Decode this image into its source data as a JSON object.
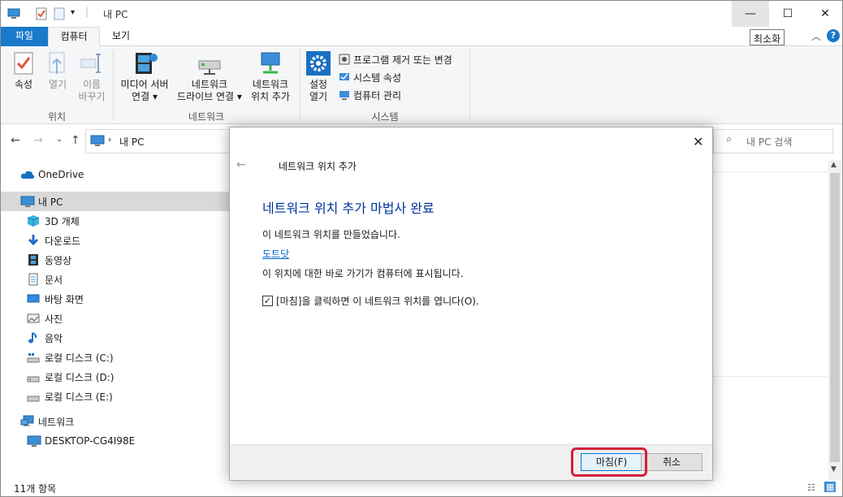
{
  "window": {
    "title": "내 PC",
    "minimize_tooltip": "최소화"
  },
  "ribbon": {
    "tabs": {
      "file": "파일",
      "computer": "컴퓨터",
      "view": "보기"
    },
    "groups": {
      "location": "위치",
      "network": "네트워크",
      "system": "시스템"
    },
    "buttons": {
      "properties": "속성",
      "open": "열기",
      "rename_1": "이름",
      "rename_2": "바꾸기",
      "media_server_1": "미디어 서버",
      "media_server_2": "연결",
      "map_drive_1": "네트워크",
      "map_drive_2": "드라이브 연결",
      "add_location_1": "네트워크",
      "add_location_2": "위치 추가",
      "settings_1": "설정",
      "settings_2": "열기",
      "uninstall": "프로그램 제거 또는 변경",
      "system_properties": "시스템 속성",
      "manage": "컴퓨터 관리"
    }
  },
  "address": {
    "path": "내 PC",
    "search_placeholder": "내 PC 검색"
  },
  "nav": {
    "onedrive": "OneDrive",
    "mypc": "내 PC",
    "items": [
      "3D 개체",
      "다운로드",
      "동영상",
      "문서",
      "바탕 화면",
      "사진",
      "음악",
      "로컬 디스크 (C:)",
      "로컬 디스크 (D:)",
      "로컬 디스크 (E:)"
    ],
    "network": "네트워크",
    "desktop": "DESKTOP-CG4I98E"
  },
  "status": {
    "count": "11개 항목"
  },
  "dialog": {
    "title": "네트워크 위치 추가",
    "heading": "네트워크 위치 추가 마법사 완료",
    "message": "이 네트워크 위치를 만들었습니다.",
    "link": "도트닷",
    "description": "이 위치에 대한 바로 가기가 컴퓨터에 표시됩니다.",
    "checkbox_label": "[마침]을 클릭하면 이 네트워크 위치를 엽니다(O).",
    "checkbox_checked": true,
    "finish": "마침(F)",
    "cancel": "취소"
  },
  "colors": {
    "file_tab": "#1979ca",
    "heading": "#003399",
    "highlight": "#d0213a"
  }
}
